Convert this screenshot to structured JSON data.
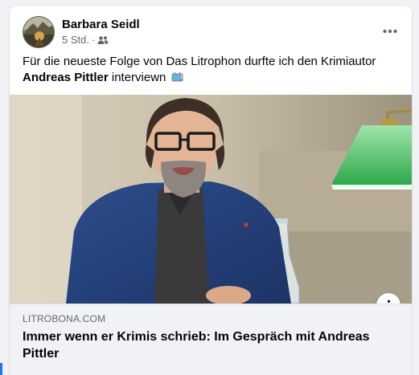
{
  "post": {
    "author": "Barbara Seidl",
    "time": "5 Std.",
    "separator": "·",
    "audience_icon": "friends-icon",
    "text_before": "Für die neueste Folge von Das Litrophon durfte ich den Krimiautor",
    "text_bold": "Andreas Pittler",
    "text_after": "interviewn",
    "emoji": "television-emoji"
  },
  "link": {
    "domain": "LITROBONA.COM",
    "title": "Immer wenn er Krimis schrieb: Im Gespräch mit Andreas Pittler",
    "info_icon": "info-icon"
  },
  "colors": {
    "accent": "#1877f2",
    "secondary_text": "#65676b",
    "caption_bg": "#f0f2f5"
  }
}
